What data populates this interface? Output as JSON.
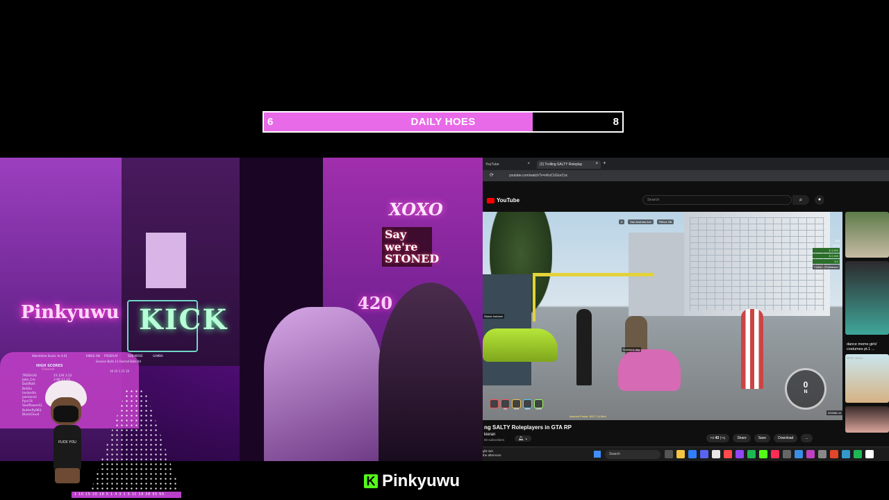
{
  "goal": {
    "title": "DAILY HOES",
    "current": "6",
    "target": "8",
    "fill_fraction": 0.75,
    "fill_color": "#e86ae8"
  },
  "webcam": {
    "neon_signs": {
      "pinky": "Pinkyuwu",
      "kick": "KICK",
      "xoxo": "XOXO",
      "stoned": "Say we're STONED",
      "sign420": "420"
    }
  },
  "stats": {
    "watch_time": "Watchtime Score: to 4:41",
    "high_scores_title": "HIGH SCORES",
    "high_scores_sub": "Channel",
    "rows": [
      "TREEHUG",
      "Jake_Cre",
      "DuttRott",
      "BeSSa",
      "lavlandia",
      "jasmonsil",
      "Pyrz74",
      "Soulflower42",
      "Butterfly963",
      "BlackCloud"
    ],
    "row_vals": [
      "23  12K  3.52",
      "3   66  11.23",
      "",
      "",
      "",
      "",
      "",
      "",
      "",
      ""
    ],
    "labels": [
      "KINGS ON",
      "FREEPLAY",
      "SUB MODE",
      "GAMBA"
    ],
    "session": "Session Balls  13     Overall Balls  84",
    "bottom_nums": "10  10  1  21  10"
  },
  "avatar": {
    "shirt_text": "FUCK YOU"
  },
  "number_strip": "1  10  15  20  18  5  1  4  3  1  5  11  18  28  55  56",
  "brand": {
    "logo_letter": "K",
    "name": "Pinkyuwu",
    "logo_color": "#53fc18"
  },
  "browser": {
    "tabs": [
      {
        "label": "YouTube"
      },
      {
        "label": "(2) Trolling SALTY Roleplay"
      }
    ],
    "url": "youtube.com/watch?v=nKoCUGorCsc",
    "yt_logo_text": "YouTube",
    "search_placeholder": "Search",
    "video": {
      "hud_top": [
        "9",
        "San Andreas Ave",
        "Pillbox Hill"
      ],
      "hud_right": [
        "323",
        "29:00",
        "$ 4,650",
        "$ 2,450",
        "$ 0"
      ],
      "role": "Civilian | Freelancer",
      "nick_label": "Stoner Iceheze",
      "bike_label": "Sunshine day",
      "status_vals": [
        "",
        "0%",
        "92%",
        "95%",
        "100%"
      ],
      "street": "Nearest Postal: 8037  CA Blvd",
      "speed": "0",
      "gear": "N",
      "odometer": "000086 mi"
    },
    "video_title": "ng SALTY Roleplayers in GTA RP",
    "channel": "kieran",
    "subscribers": "80 subscribers",
    "actions": {
      "likes": "43",
      "share": "Share",
      "save": "Save",
      "download": "Download",
      "more": "..."
    },
    "recommended": {
      "title": "dance moms girls' costumes pt.1 ...",
      "views": "953K views"
    },
    "taskbar": {
      "weather_line1": "ght rain",
      "weather_line2": "the afternoon",
      "search": "Search"
    }
  }
}
